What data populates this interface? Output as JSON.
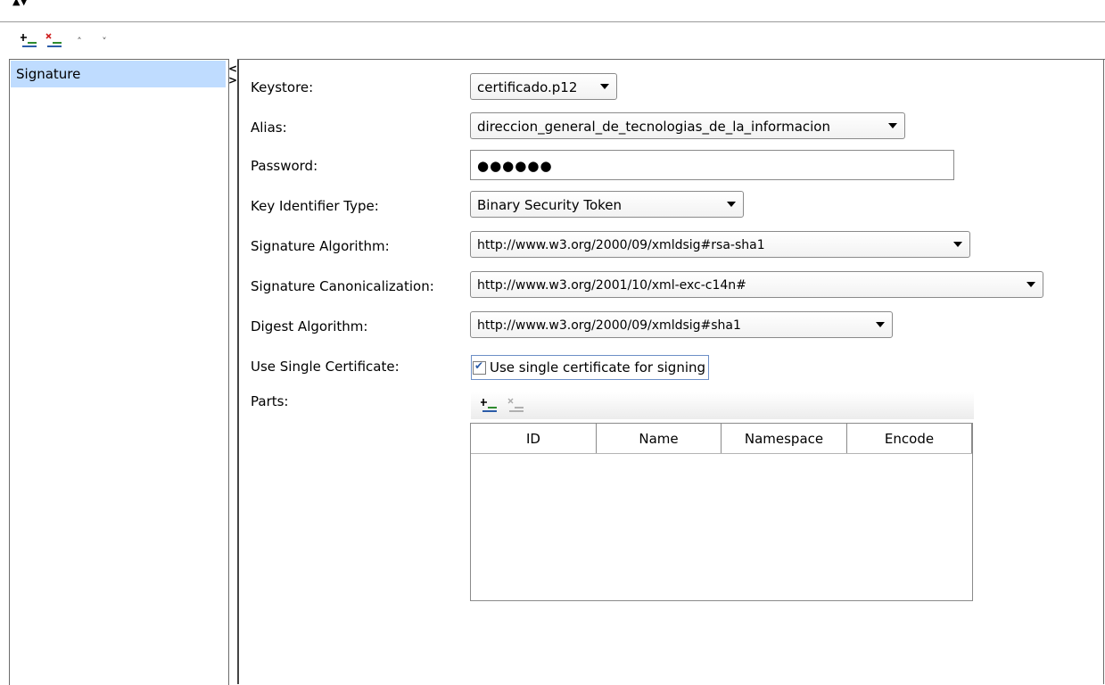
{
  "toolbar": {
    "add_icon": "add-item-icon",
    "remove_icon": "remove-item-icon",
    "move_up": "˄",
    "move_down": "˅"
  },
  "collapse_arrows": "▲▼",
  "tree": {
    "items": [
      {
        "label": "Signature",
        "selected": true
      }
    ]
  },
  "splitter": {
    "left": "<",
    "right": ">"
  },
  "form": {
    "keystore": {
      "label": "Keystore:",
      "value": "certificado.p12"
    },
    "alias": {
      "label": "Alias:",
      "value": "direccion_general_de_tecnologias_de_la_informacion"
    },
    "password": {
      "label": "Password:",
      "value": "●●●●●●"
    },
    "key_identifier_type": {
      "label": "Key Identifier Type:",
      "value": "Binary Security Token"
    },
    "signature_algorithm": {
      "label": "Signature Algorithm:",
      "value": "http://www.w3.org/2000/09/xmldsig#rsa-sha1"
    },
    "signature_canonicalization": {
      "label": "Signature Canonicalization:",
      "value": "http://www.w3.org/2001/10/xml-exc-c14n#"
    },
    "digest_algorithm": {
      "label": "Digest Algorithm:",
      "value": "http://www.w3.org/2000/09/xmldsig#sha1"
    },
    "use_single_certificate": {
      "label": "Use Single Certificate:",
      "checkbox_label": "Use single certificate for signing",
      "checked": true
    },
    "parts": {
      "label": "Parts:",
      "columns": [
        "ID",
        "Name",
        "Namespace",
        "Encode"
      ]
    }
  },
  "colors": {
    "selection": "#bfdcff",
    "check_accent": "#2b5ca8",
    "add_green": "#2e8b2e",
    "remove_red": "#d02020"
  }
}
